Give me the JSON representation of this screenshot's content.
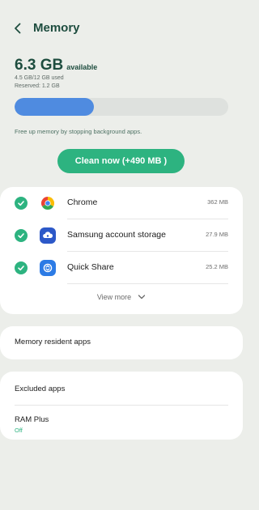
{
  "header": {
    "title": "Memory",
    "back_icon": "chevron-left-icon"
  },
  "summary": {
    "available_value": "6.3 GB",
    "available_label": "available",
    "used_text": "4.5 GB/12 GB used",
    "reserved_text": "Reserved: 1.2 GB",
    "used_fraction": 0.37
  },
  "hint": "Free up memory by stopping background apps.",
  "clean_button": "Clean now (+490 MB )",
  "apps": [
    {
      "name": "Chrome",
      "size": "362 MB",
      "icon": "chrome-icon",
      "checked": true
    },
    {
      "name": "Samsung account storage",
      "size": "27.9 MB",
      "icon": "samsung-cloud-icon",
      "checked": true
    },
    {
      "name": "Quick Share",
      "size": "25.2 MB",
      "icon": "quick-share-icon",
      "checked": true
    }
  ],
  "view_more": "View more",
  "memory_resident_apps": "Memory resident apps",
  "excluded_apps": "Excluded apps",
  "ram_plus": {
    "label": "RAM Plus",
    "value": "Off"
  },
  "colors": {
    "accent": "#2DB380",
    "title": "#1E4D3F",
    "progress": "#4F8BE0",
    "background": "#ECEEEA"
  }
}
